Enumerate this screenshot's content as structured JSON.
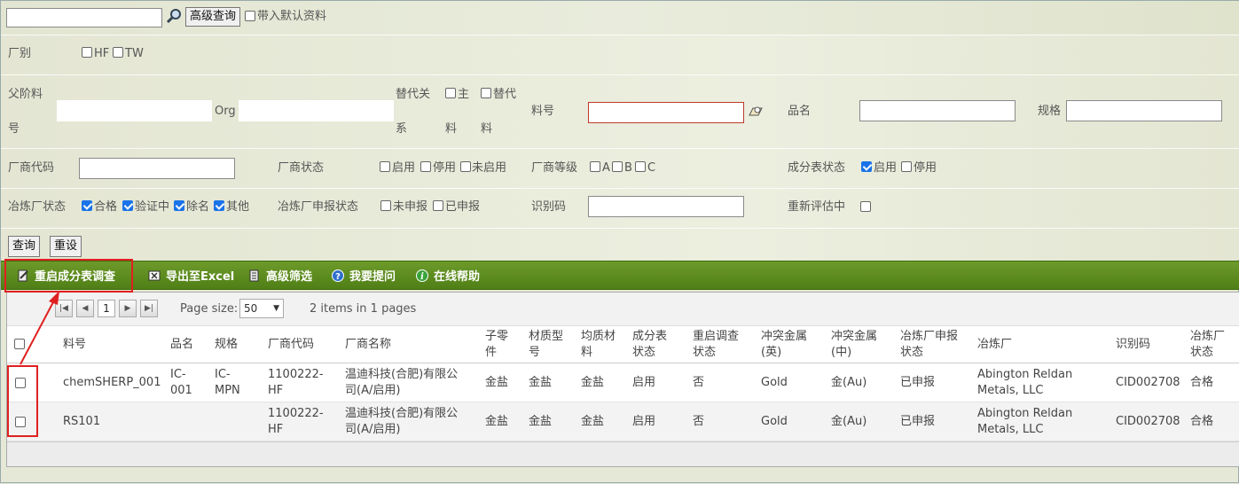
{
  "search": {
    "value": "",
    "advanced_button": "高级查询",
    "include_default_label": "带入默认资料"
  },
  "factory": {
    "label": "厂别",
    "options": [
      "HF",
      "TW"
    ]
  },
  "row2": {
    "parent_label_a": "父阶料",
    "parent_label_b": "号",
    "org_label": "Org",
    "replace_label_a": "替代关",
    "replace_label_b": "系",
    "main_label_a": "主",
    "main_label_b": "料",
    "sub_label_a": "替代",
    "sub_label_b": "料",
    "part_label": "料号",
    "name_label": "品名",
    "spec_label": "规格"
  },
  "row3": {
    "vendor_code_label": "厂商代码",
    "vendor_status_label": "厂商状态",
    "vendor_status_options": [
      "启用",
      "停用",
      "未启用"
    ],
    "vendor_grade_label": "厂商等级",
    "vendor_grade_options": [
      "A",
      "B",
      "C"
    ],
    "composition_status_label": "成分表状态",
    "composition_options": [
      "启用",
      "停用"
    ]
  },
  "row4": {
    "smelter_status_label": "冶炼厂状态",
    "smelter_options": [
      "合格",
      "验证中",
      "除名",
      "其他"
    ],
    "smelter_report_label": "冶炼厂申报状态",
    "smelter_report_options": [
      "未申报",
      "已申报"
    ],
    "id_code_label": "识别码",
    "reeval_label": "重新评估中"
  },
  "actions": {
    "query": "查询",
    "reset": "重设"
  },
  "toolbar": {
    "restart": "重启成分表调查",
    "export": "导出至Excel",
    "filter": "高级筛选",
    "ask": "我要提问",
    "help": "在线帮助"
  },
  "pager": {
    "page": "1",
    "page_size_label": "Page size:",
    "page_size": "50",
    "info": "2 items in 1 pages"
  },
  "columns": {
    "part": "料号",
    "name": "品名",
    "spec": "规格",
    "vcode": "厂商代码",
    "vname": "厂商名称",
    "sub_a": "子零",
    "sub_b": "件",
    "mat_a": "材质型",
    "mat_b": "号",
    "hom_a": "均质材",
    "hom_b": "料",
    "comp_a": "成分表",
    "comp_b": "状态",
    "restart_a": "重启调查",
    "restart_b": "状态",
    "metal_en_a": "冲突金属",
    "metal_en_b": "(英)",
    "metal_cn_a": "冲突金属",
    "metal_cn_b": "(中)",
    "report_a": "冶炼厂申报",
    "report_b": "状态",
    "smelter": "冶炼厂",
    "idcode": "识别码",
    "sstatus_a": "冶炼厂",
    "sstatus_b": "状态"
  },
  "rows": [
    {
      "part": "chemSHERP_001",
      "name_a": "IC-",
      "name_b": "001",
      "spec_a": "IC-",
      "spec_b": "MPN",
      "vcode_a": "1100222-",
      "vcode_b": "HF",
      "vname_a": "温迪科技(合肥)有限公",
      "vname_b": "司(A/启用)",
      "sub": "金盐",
      "mat": "金盐",
      "hom": "金盐",
      "comp": "启用",
      "restart": "否",
      "metal_en": "Gold",
      "metal_cn": "金(Au)",
      "report": "已申报",
      "smelter_a": "Abington Reldan",
      "smelter_b": "Metals, LLC",
      "idcode": "CID002708",
      "sstatus": "合格"
    },
    {
      "part": "RS101",
      "name_a": "",
      "name_b": "",
      "spec_a": "",
      "spec_b": "",
      "vcode_a": "1100222-",
      "vcode_b": "HF",
      "vname_a": "温迪科技(合肥)有限公",
      "vname_b": "司(A/启用)",
      "sub": "金盐",
      "mat": "金盐",
      "hom": "金盐",
      "comp": "启用",
      "restart": "否",
      "metal_en": "Gold",
      "metal_cn": "金(Au)",
      "report": "已申报",
      "smelter_a": "Abington Reldan",
      "smelter_b": "Metals, LLC",
      "idcode": "CID002708",
      "sstatus": "合格"
    }
  ],
  "colors": {
    "toolbar_green": "#5a8a1e",
    "highlight_red": "#e02020",
    "checkbox_blue": "#1a73e8"
  }
}
